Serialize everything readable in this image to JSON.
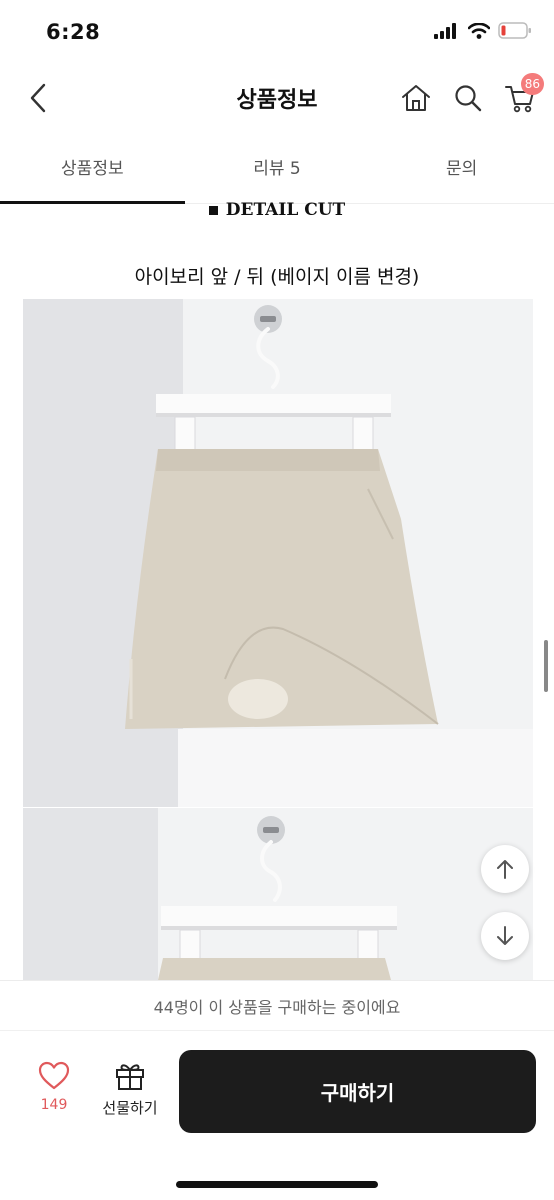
{
  "status": {
    "time": "6:28"
  },
  "header": {
    "title": "상품정보",
    "cart_count": "86"
  },
  "tabs": [
    {
      "label": "상품정보",
      "active": true
    },
    {
      "label": "리뷰 5",
      "active": false
    },
    {
      "label": "문의",
      "active": false
    }
  ],
  "content": {
    "section_heading": "DETAIL CUT",
    "caption": "아이보리 앞 / 뒤 (베이지 이름 변경)"
  },
  "bottom": {
    "buying_notice": "44명이 이 상품을 구매하는 중이에요",
    "like_count": "149",
    "gift_label": "선물하기",
    "buy_label": "구매하기"
  },
  "colors": {
    "accent": "#f47b7b",
    "like": "#e0595b",
    "buy_button": "#1c1c1c",
    "skirt": "#d9d2c4"
  }
}
